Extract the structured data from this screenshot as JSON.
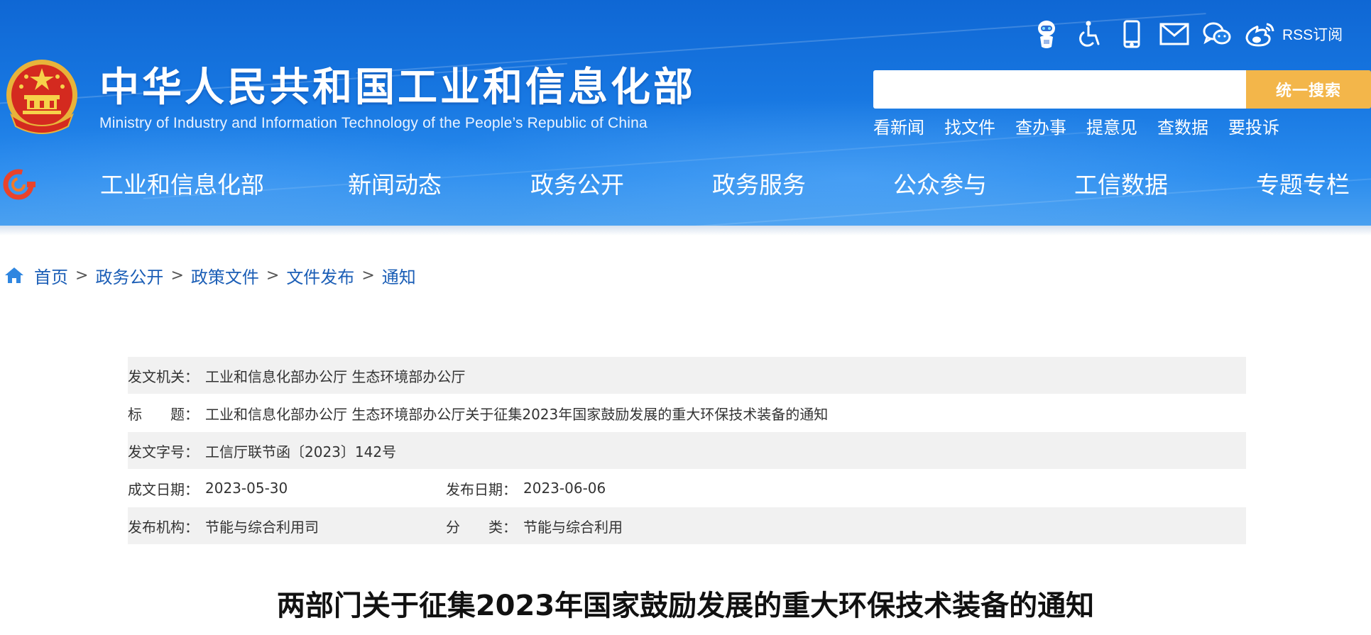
{
  "header": {
    "site_title": "中华人民共和国工业和信息化部",
    "site_subtitle": "Ministry of Industry and Information Technology of the People’s Republic of China",
    "top_icons": [
      "robot-assistant-icon",
      "accessibility-icon",
      "mobile-icon",
      "mail-icon",
      "wechat-icon",
      "weibo-icon"
    ],
    "rss_label": "RSS订阅",
    "search": {
      "placeholder": "",
      "value": "",
      "button_label": "统一搜索"
    },
    "quick_links": [
      "看新闻",
      "找文件",
      "查办事",
      "提意见",
      "查数据",
      "要投诉"
    ],
    "colors": {
      "header_blue": "#1878e2",
      "search_button": "#f3b64a"
    }
  },
  "nav": {
    "items": [
      "工业和信息化部",
      "新闻动态",
      "政务公开",
      "政务服务",
      "公众参与",
      "工信数据",
      "专题专栏"
    ]
  },
  "breadcrumb": {
    "items": [
      "首页",
      "政务公开",
      "政策文件",
      "文件发布",
      "通知"
    ],
    "separator": ">"
  },
  "meta": {
    "issuer": {
      "label": "发文机关：",
      "value": "工业和信息化部办公厅 生态环境部办公厅"
    },
    "title": {
      "label": "标　　题：",
      "value": "工业和信息化部办公厅 生态环境部办公厅关于征集2023年国家鼓励发展的重大环保技术装备的通知"
    },
    "doc_number": {
      "label": "发文字号：",
      "value": "工信厅联节函〔2023〕142号"
    },
    "written_date": {
      "label": "成文日期：",
      "value": "2023-05-30"
    },
    "publish_date": {
      "label": "发布日期：",
      "value": "2023-06-06"
    },
    "publisher": {
      "label": "发布机构：",
      "value": "节能与综合利用司"
    },
    "category": {
      "label": "分　　类：",
      "value": "节能与综合利用"
    }
  },
  "article": {
    "title": "两部门关于征集2023年国家鼓励发展的重大环保技术装备的通知"
  }
}
